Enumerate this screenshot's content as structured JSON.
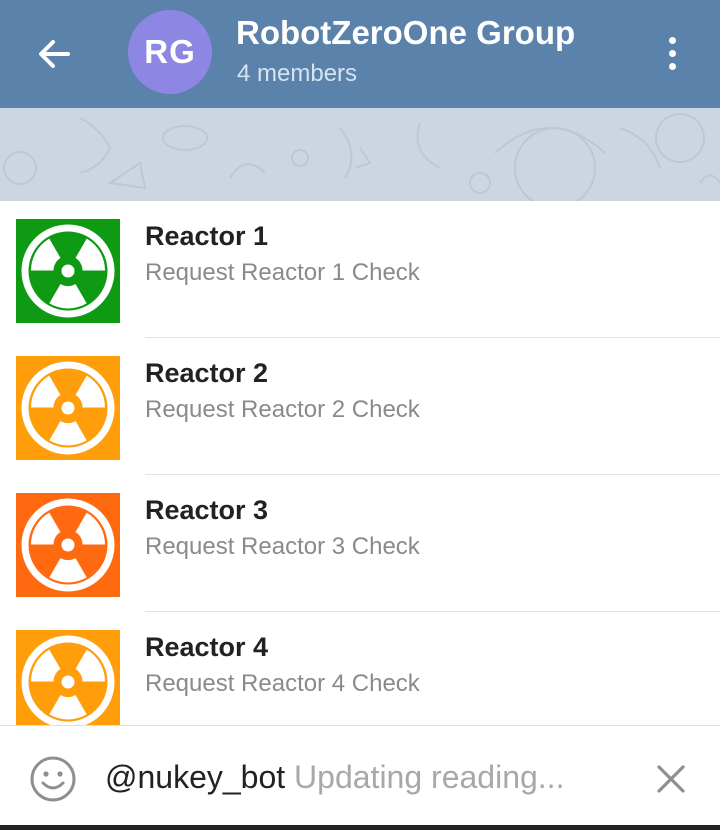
{
  "header": {
    "avatar_initials": "RG",
    "title": "RobotZeroOne Group",
    "subtitle": "4 members",
    "back_icon": "arrow-back-icon",
    "menu_icon": "more-vertical-icon",
    "bar_color": "#5a82aa",
    "avatar_color": "#8e86e3"
  },
  "results": [
    {
      "title": "Reactor 1",
      "description": "Request Reactor 1 Check",
      "color": "#0f9a14",
      "icon": "radiation-icon"
    },
    {
      "title": "Reactor 2",
      "description": "Request Reactor 2 Check",
      "color": "#ff9d0a",
      "icon": "radiation-icon"
    },
    {
      "title": "Reactor 3",
      "description": "Request Reactor 3 Check",
      "color": "#ff6a10",
      "icon": "radiation-icon"
    },
    {
      "title": "Reactor 4",
      "description": "Request Reactor 4 Check",
      "color": "#ff9d0a",
      "icon": "radiation-icon"
    }
  ],
  "input": {
    "value": "@nukey_bot",
    "placeholder": "Updating reading...",
    "emoji_icon": "smiley-icon",
    "clear_icon": "close-icon"
  }
}
